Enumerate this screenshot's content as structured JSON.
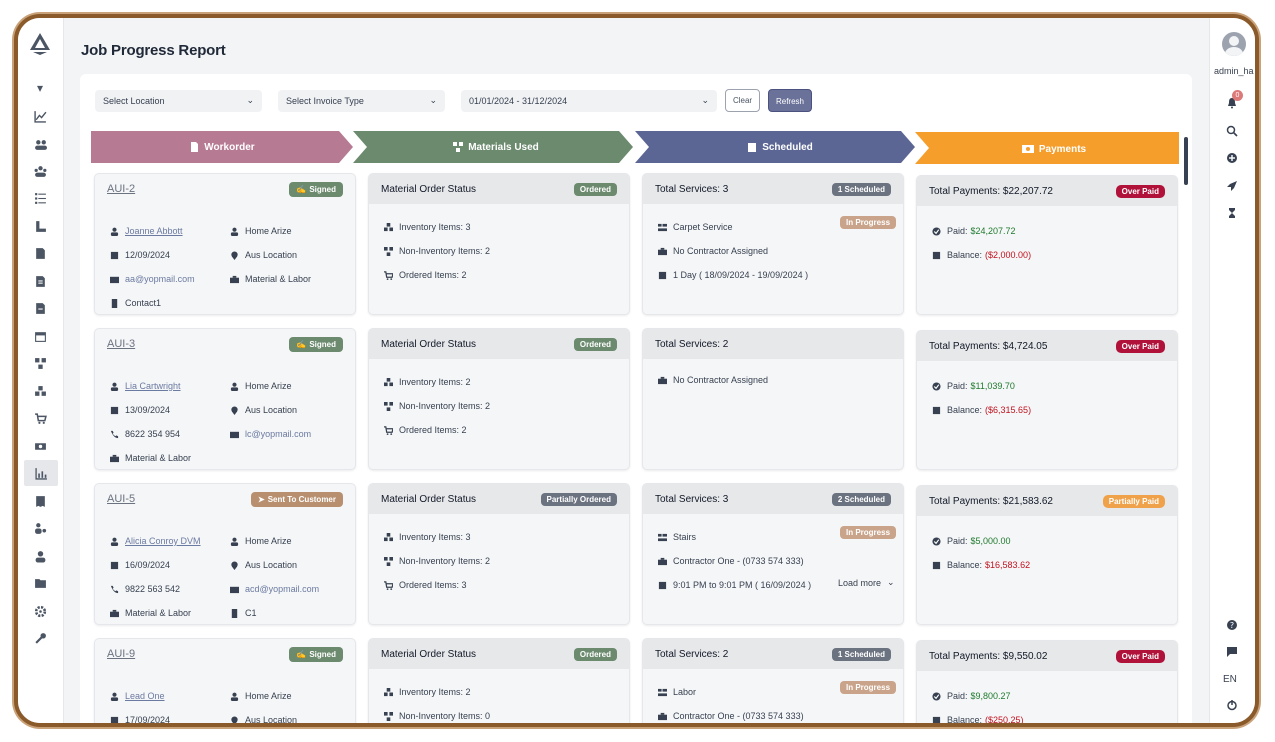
{
  "page": {
    "title": "Job Progress Report"
  },
  "user": {
    "name": "admin_ha",
    "notifications": "0",
    "language": "EN"
  },
  "filters": {
    "location": "Select Location",
    "invoice_type": "Select Invoice Type",
    "date_range": "01/01/2024 - 31/12/2024",
    "clear": "Clear",
    "refresh": "Refresh"
  },
  "stages": {
    "workorder": "Workorder",
    "materials": "Materials Used",
    "scheduled": "Scheduled",
    "payments": "Payments"
  },
  "colors": {
    "workorder": "#b77a93",
    "materials": "#6b8a6e",
    "scheduled": "#5c6694",
    "payments": "#f59e2b"
  },
  "rows": [
    {
      "wo": {
        "id": "AUI-2",
        "status": "Signed",
        "customer": "Joanne Abbott",
        "date": "12/09/2024",
        "email": "aa@yopmail.com",
        "contact": "Contact1",
        "location_type": "Home Arize",
        "location": "Aus Location",
        "job_type": "Material & Labor"
      },
      "mat": {
        "title": "Material Order Status",
        "status": "Ordered",
        "inventory": "Inventory Items: 3",
        "non_inventory": "Non-Inventory Items: 2",
        "ordered": "Ordered Items: 2"
      },
      "sch": {
        "title": "Total Services: 3",
        "badge": "1 Scheduled",
        "service": "Carpet Service",
        "service_status": "In Progress",
        "contractor": "No Contractor Assigned",
        "period": "1 Day ( 18/09/2024 - 19/09/2024 )"
      },
      "pay": {
        "title": "Total Payments: $22,207.72",
        "status": "Over Paid",
        "paid_label": "Paid:",
        "paid": "$24,207.72",
        "balance_label": "Balance:",
        "balance": "($2,000.00)"
      }
    },
    {
      "wo": {
        "id": "AUI-3",
        "status": "Signed",
        "customer": "Lia Cartwright",
        "date": "13/09/2024",
        "phone": "8622 354 954",
        "job_type": "Material & Labor",
        "location_type": "Home Arize",
        "location": "Aus Location",
        "email": "lc@yopmail.com"
      },
      "mat": {
        "title": "Material Order Status",
        "status": "Ordered",
        "inventory": "Inventory Items: 2",
        "non_inventory": "Non-Inventory Items: 2",
        "ordered": "Ordered Items: 2"
      },
      "sch": {
        "title": "Total Services: 2",
        "contractor": "No Contractor Assigned"
      },
      "pay": {
        "title": "Total Payments: $4,724.05",
        "status": "Over Paid",
        "paid_label": "Paid:",
        "paid": "$11,039.70",
        "balance_label": "Balance:",
        "balance": "($6,315.65)"
      }
    },
    {
      "wo": {
        "id": "AUI-5",
        "status": "Sent To Customer",
        "customer": "Alicia Conroy DVM",
        "date": "16/09/2024",
        "phone": "9822 563 542",
        "job_type": "Material & Labor",
        "location_type": "Home Arize",
        "location": "Aus Location",
        "email": "acd@yopmail.com",
        "contact": "C1"
      },
      "mat": {
        "title": "Material Order Status",
        "status": "Partially Ordered",
        "inventory": "Inventory Items: 3",
        "non_inventory": "Non-Inventory Items: 2",
        "ordered": "Ordered Items: 3"
      },
      "sch": {
        "title": "Total Services: 3",
        "badge": "2 Scheduled",
        "service": "Stairs",
        "service_status": "In Progress",
        "contractor": "Contractor One - (0733 574 333)",
        "period": "9:01 PM to 9:01 PM ( 16/09/2024 )",
        "more": "Load more"
      },
      "pay": {
        "title": "Total Payments: $21,583.62",
        "status": "Partially Paid",
        "paid_label": "Paid:",
        "paid": "$5,000.00",
        "balance_label": "Balance:",
        "balance": "$16,583.62"
      }
    },
    {
      "wo": {
        "id": "AUI-9",
        "status": "Signed",
        "customer": "Lead One",
        "date": "17/09/2024",
        "location_type": "Home Arize",
        "location": "Aus Location"
      },
      "mat": {
        "title": "Material Order Status",
        "status": "Ordered",
        "inventory": "Inventory Items: 2",
        "non_inventory": "Non-Inventory Items: 0"
      },
      "sch": {
        "title": "Total Services: 2",
        "badge": "1 Scheduled",
        "service": "Labor",
        "service_status": "In Progress",
        "contractor": "Contractor One - (0733 574 333)"
      },
      "pay": {
        "title": "Total Payments: $9,550.02",
        "status": "Over Paid",
        "paid_label": "Paid:",
        "paid": "$9,800.27",
        "balance_label": "Balance:",
        "balance": "($250.25)"
      }
    }
  ]
}
